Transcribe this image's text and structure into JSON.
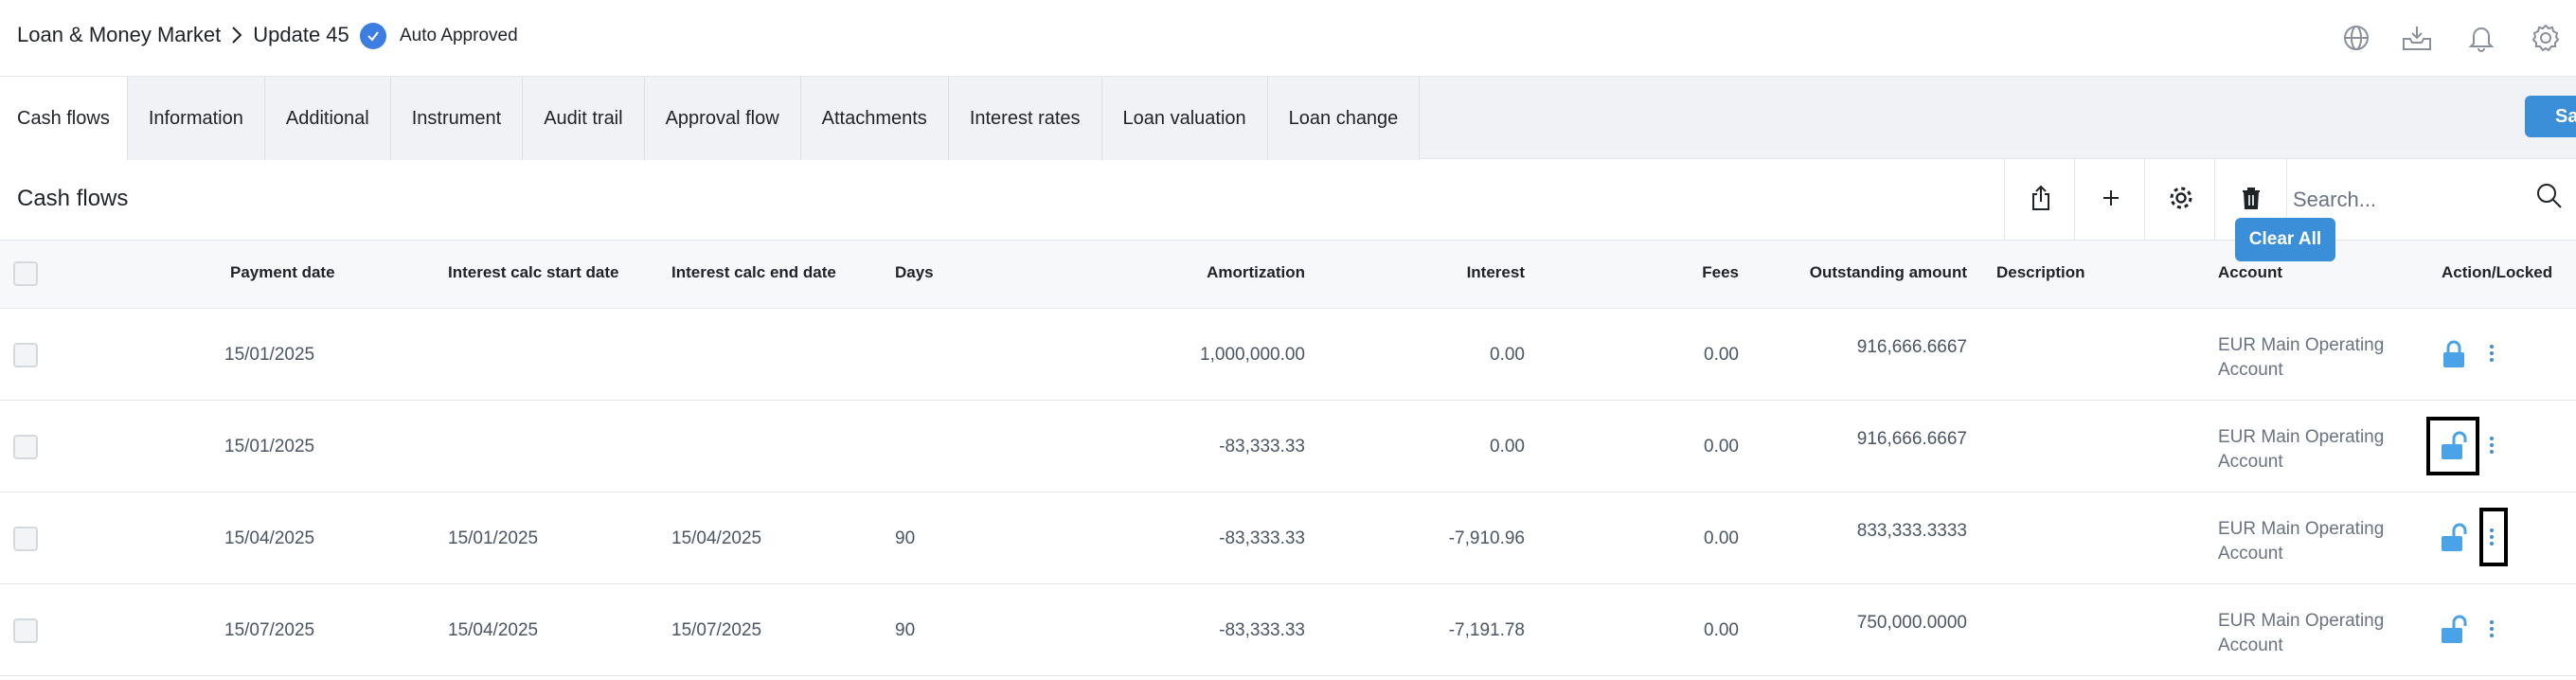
{
  "header": {
    "breadcrumb_parent": "Loan & Money Market",
    "breadcrumb_current": "Update 45",
    "status": "Auto Approved"
  },
  "header_icons": [
    "globe-icon",
    "inbox-download-icon",
    "bell-icon",
    "gear-icon"
  ],
  "tabs": [
    {
      "label": "Cash flows",
      "active": true
    },
    {
      "label": "Information"
    },
    {
      "label": "Additional"
    },
    {
      "label": "Instrument"
    },
    {
      "label": "Audit trail"
    },
    {
      "label": "Approval flow"
    },
    {
      "label": "Attachments"
    },
    {
      "label": "Interest rates"
    },
    {
      "label": "Loan valuation"
    },
    {
      "label": "Loan change"
    }
  ],
  "save_label": "Sa",
  "section": {
    "title": "Cash flows",
    "tools": [
      "share-icon",
      "plus-icon",
      "settings-icon",
      "trash-icon"
    ],
    "search_placeholder": "Search...",
    "clear_all": "Clear All"
  },
  "table": {
    "columns": {
      "payment_date": "Payment date",
      "calc_start": "Interest calc start date",
      "calc_end": "Interest calc end date",
      "days": "Days",
      "amortization": "Amortization",
      "interest": "Interest",
      "fees": "Fees",
      "outstanding": "Outstanding amount",
      "description": "Description",
      "account": "Account",
      "action": "Action/Locked"
    },
    "rows": [
      {
        "payment_date": "15/01/2025",
        "calc_start": "",
        "calc_end": "",
        "days": "",
        "amortization": "1,000,000.00",
        "interest": "0.00",
        "fees": "0.00",
        "outstanding": "916,666.6667",
        "description": "",
        "account_line1": "EUR Main Operating",
        "account_line2": "Account",
        "locked": true
      },
      {
        "payment_date": "15/01/2025",
        "calc_start": "",
        "calc_end": "",
        "days": "",
        "amortization": "-83,333.33",
        "interest": "0.00",
        "fees": "0.00",
        "outstanding": "916,666.6667",
        "description": "",
        "account_line1": "EUR Main Operating",
        "account_line2": "Account",
        "locked": false
      },
      {
        "payment_date": "15/04/2025",
        "calc_start": "15/01/2025",
        "calc_end": "15/04/2025",
        "days": "90",
        "amortization": "-83,333.33",
        "interest": "-7,910.96",
        "fees": "0.00",
        "outstanding": "833,333.3333",
        "description": "",
        "account_line1": "EUR Main Operating",
        "account_line2": "Account",
        "locked": false
      },
      {
        "payment_date": "15/07/2025",
        "calc_start": "15/04/2025",
        "calc_end": "15/07/2025",
        "days": "90",
        "amortization": "-83,333.33",
        "interest": "-7,191.78",
        "fees": "0.00",
        "outstanding": "750,000.0000",
        "description": "",
        "account_line1": "EUR Main Operating",
        "account_line2": "Account",
        "locked": false
      }
    ]
  },
  "colors": {
    "accent": "#3b8fd9",
    "lock": "#4aa3e6",
    "check": "#3b7de0"
  }
}
